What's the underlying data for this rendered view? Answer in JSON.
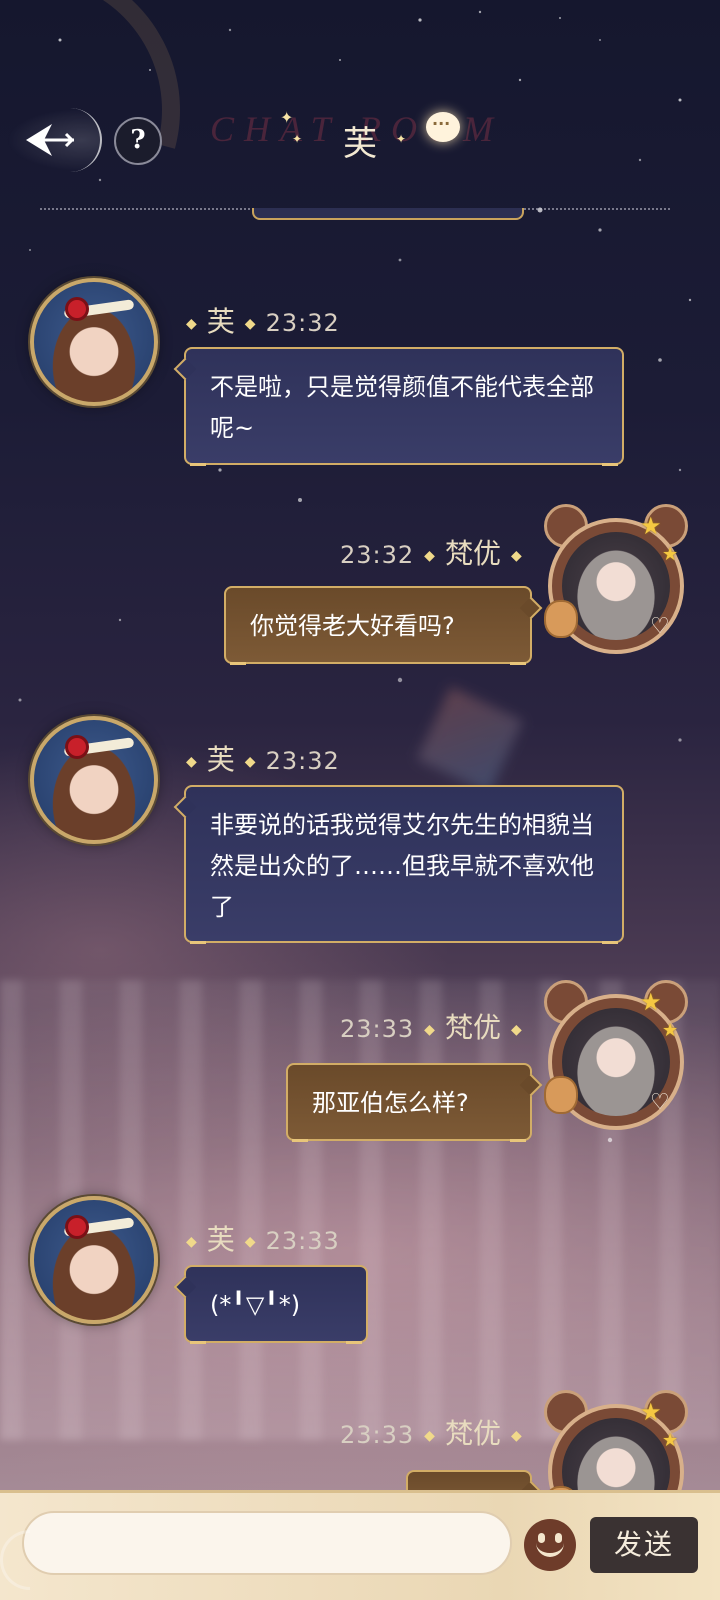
{
  "header": {
    "title": "芙",
    "watermark": "CHAT ROOM",
    "help_label": "?"
  },
  "messages": [
    {
      "sender": "芙",
      "time": "23:32",
      "side": "left",
      "text": "不是啦，只是觉得颜值不能代表全部呢~"
    },
    {
      "sender": "梵优",
      "time": "23:32",
      "side": "right",
      "text": "你觉得老大好看吗?"
    },
    {
      "sender": "芙",
      "time": "23:32",
      "side": "left",
      "text": "非要说的话我觉得艾尔先生的相貌当然是出众的了……但我早就不喜欢他了"
    },
    {
      "sender": "梵优",
      "time": "23:33",
      "side": "right",
      "text": "那亚伯怎么样?"
    },
    {
      "sender": "芙",
      "time": "23:33",
      "side": "left",
      "text": "(*╹▽╹*)"
    },
    {
      "sender": "梵优",
      "time": "23:33",
      "side": "right",
      "text": ""
    }
  ],
  "input": {
    "value": "",
    "placeholder": "",
    "send_label": "发送"
  },
  "icons": {
    "back": "back-arrow-icon",
    "help": "help-icon",
    "chat": "chat-bubble-icon",
    "emoji": "emoji-icon"
  },
  "colors": {
    "bubble_left": "#2f325a",
    "bubble_right": "#6a4a2a",
    "bubble_border": "#d2ad66",
    "send_button": "#3a3232"
  }
}
